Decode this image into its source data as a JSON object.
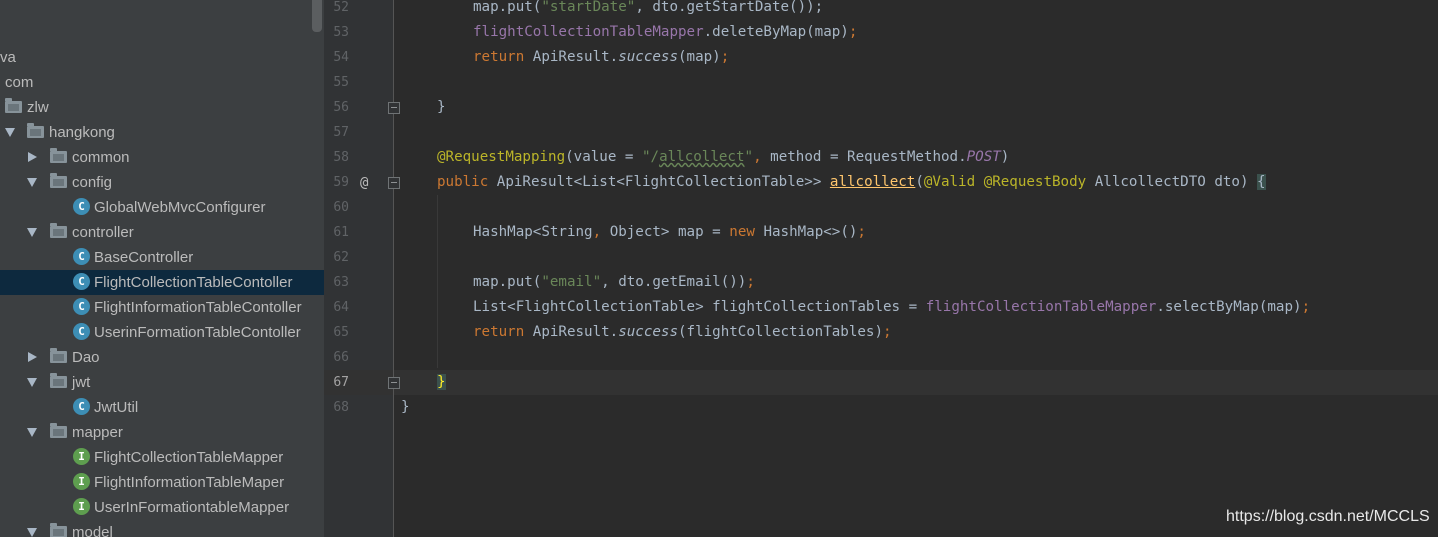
{
  "tree": {
    "items": [
      {
        "label": "va",
        "kind": "text"
      },
      {
        "label": "com",
        "kind": "text"
      },
      {
        "label": "zlw",
        "kind": "folder"
      },
      {
        "label": "hangkong",
        "kind": "folder",
        "state": "expanded"
      },
      {
        "label": "common",
        "kind": "folder",
        "state": "collapsed"
      },
      {
        "label": "config",
        "kind": "folder",
        "state": "expanded"
      },
      {
        "label": "GlobalWebMvcConfigurer",
        "kind": "class",
        "icon_letter": "C"
      },
      {
        "label": "controller",
        "kind": "folder",
        "state": "expanded"
      },
      {
        "label": "BaseController",
        "kind": "class",
        "icon_letter": "C"
      },
      {
        "label": "FlightCollectionTableContoller",
        "kind": "class",
        "icon_letter": "C",
        "selected": true
      },
      {
        "label": "FlightInformationTableContoller",
        "kind": "class",
        "icon_letter": "C"
      },
      {
        "label": "UserinFormationTableContoller",
        "kind": "class",
        "icon_letter": "C"
      },
      {
        "label": "Dao",
        "kind": "folder",
        "state": "collapsed"
      },
      {
        "label": "jwt",
        "kind": "folder",
        "state": "expanded"
      },
      {
        "label": "JwtUtil",
        "kind": "class",
        "icon_letter": "C"
      },
      {
        "label": "mapper",
        "kind": "folder",
        "state": "expanded"
      },
      {
        "label": "FlightCollectionTableMapper",
        "kind": "interface",
        "icon_letter": "I"
      },
      {
        "label": "FlightInformationTableMaper",
        "kind": "interface",
        "icon_letter": "I"
      },
      {
        "label": "UserInFormationtableMapper",
        "kind": "interface",
        "icon_letter": "I"
      },
      {
        "label": "model",
        "kind": "folder",
        "state": "expanded"
      }
    ]
  },
  "editor": {
    "line_numbers": [
      "52",
      "53",
      "54",
      "55",
      "56",
      "57",
      "58",
      "59",
      "60",
      "61",
      "62",
      "63",
      "64",
      "65",
      "66",
      "67",
      "68"
    ],
    "current_line": "67",
    "override_marker": "@",
    "code": {
      "l52": {
        "a": "map.put(",
        "b": "\"startDate\"",
        "c": ", dto.getStartDate());"
      },
      "l53": {
        "a": "flightCollectionTableMapper",
        "b": ".deleteByMap(map)",
        "c": ";"
      },
      "l54": {
        "a": "return ",
        "b": "ApiResult.",
        "c": "success",
        "d": "(map)",
        "e": ";"
      },
      "l56": {
        "a": "}"
      },
      "l58": {
        "a": "@RequestMapping",
        "b": "(value = ",
        "c": "\"/",
        "d": "allcollect",
        "e": "\"",
        "f": ", ",
        "g": "method",
        "h": " = RequestMethod.",
        "i": "POST",
        "j": ")"
      },
      "l59": {
        "a": "public ",
        "b": "ApiResult<List<FlightCollectionTable>> ",
        "c": "allcollect",
        "d": "(",
        "e": "@Valid ",
        "f": "@RequestBody ",
        "g": "AllcollectDTO dto) ",
        "h": "{"
      },
      "l61": {
        "a": "HashMap<String",
        "b": ", ",
        "c": "Object> map = ",
        "d": "new ",
        "e": "HashMap<>()",
        "f": ";"
      },
      "l63": {
        "a": "map.put(",
        "b": "\"email\"",
        "c": ", dto.getEmail())",
        "d": ";"
      },
      "l64": {
        "a": "List<FlightCollectionTable> flightCollectionTables = ",
        "b": "flightCollectionTableMapper",
        "c": ".selectByMap(map)",
        "d": ";"
      },
      "l65": {
        "a": "return ",
        "b": "ApiResult.",
        "c": "success",
        "d": "(flightCollectionTables)",
        "e": ";"
      },
      "l67": {
        "a": "}"
      },
      "l68": {
        "a": "}"
      }
    }
  },
  "watermark": "https://blog.csdn.net/MCCLS",
  "colors": {
    "tree_bg": "#3c3f41",
    "editor_bg": "#2b2b2b",
    "keyword": "#cc7832",
    "string": "#6a8759",
    "annotation": "#bbb529",
    "field": "#9876aa",
    "method_decl": "#ffc66d",
    "class_icon": "#3d8eb5",
    "interface_icon": "#5e9e4f"
  }
}
